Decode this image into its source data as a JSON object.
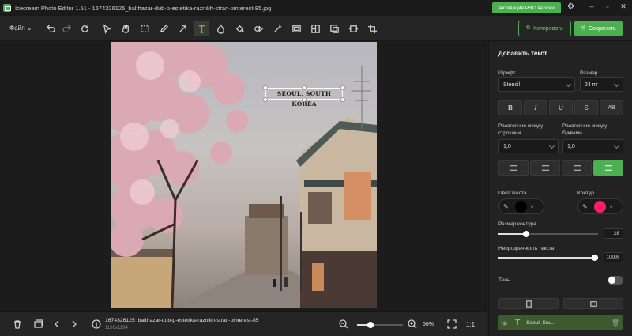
{
  "window": {
    "title": "Icecream Photo Editor 1.51 - 1674326125_balthazar-dub-p-estetika-raznikh-stran-pinterest-85.jpg",
    "pro_button": "Активация PRO версии"
  },
  "toolbar": {
    "file_menu": "Файл",
    "copy_label": "Копировать",
    "save_label": "Сохранить",
    "active_tool": "text-tool"
  },
  "canvas": {
    "overlay_text": "SEOUL, SOUTH KOREA"
  },
  "statusbar": {
    "file_name": "1674326125_balthazar-dub-p-estetika-raznikh-stran-pinterest-85",
    "dimensions": "1196x1194",
    "zoom_level": "56%",
    "zoom_fraction": 0.3,
    "actual_size": "1:1"
  },
  "panel": {
    "title": "Добавить текст",
    "font_label": "Шрифт",
    "font_value": "Stencil",
    "size_label": "Размер",
    "size_value": "24 пт",
    "line_spacing_label": "Расстояние между строками",
    "line_spacing_value": "1,0",
    "letter_spacing_label": "Расстояние между буквами",
    "letter_spacing_value": "1,0",
    "text_color_label": "Цвет текста",
    "text_color": "#000000",
    "outline_label": "Контур",
    "outline_color": "#ff1c6a",
    "outline_size_label": "Размер контура",
    "outline_size_value": "28",
    "outline_size_fraction": 0.28,
    "opacity_label": "Непрозрачность текста",
    "opacity_value": "100%",
    "opacity_fraction": 1.0,
    "shadow_label": "Тень",
    "shadow_enabled": false,
    "layer_label": "Seoul, Sou..."
  },
  "colors": {
    "accent": "#4caf50"
  }
}
